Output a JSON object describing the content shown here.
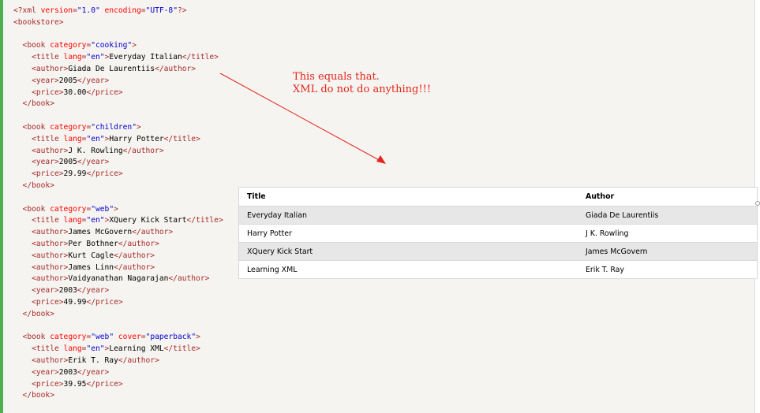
{
  "code_lines": [
    [
      {
        "c": "tag",
        "t": "<?xml "
      },
      {
        "c": "attr",
        "t": "version"
      },
      {
        "c": "tag",
        "t": "="
      },
      {
        "c": "val",
        "t": "\"1.0\""
      },
      {
        "c": "tag",
        "t": " "
      },
      {
        "c": "attr",
        "t": "encoding"
      },
      {
        "c": "tag",
        "t": "="
      },
      {
        "c": "val",
        "t": "\"UTF-8\""
      },
      {
        "c": "tag",
        "t": "?>"
      }
    ],
    [
      {
        "c": "tag",
        "t": "<bookstore>"
      }
    ],
    [],
    [
      {
        "c": "tag",
        "t": "  <book "
      },
      {
        "c": "attr",
        "t": "category"
      },
      {
        "c": "tag",
        "t": "="
      },
      {
        "c": "val",
        "t": "\"cooking\""
      },
      {
        "c": "tag",
        "t": ">"
      }
    ],
    [
      {
        "c": "tag",
        "t": "    <title "
      },
      {
        "c": "attr",
        "t": "lang"
      },
      {
        "c": "tag",
        "t": "="
      },
      {
        "c": "val",
        "t": "\"en\""
      },
      {
        "c": "tag",
        "t": ">"
      },
      {
        "c": "txt",
        "t": "Everyday Italian"
      },
      {
        "c": "tag",
        "t": "</title>"
      }
    ],
    [
      {
        "c": "tag",
        "t": "    <author>"
      },
      {
        "c": "txt",
        "t": "Giada De Laurentiis"
      },
      {
        "c": "tag",
        "t": "</author>"
      }
    ],
    [
      {
        "c": "tag",
        "t": "    <year>"
      },
      {
        "c": "txt",
        "t": "2005"
      },
      {
        "c": "tag",
        "t": "</year>"
      }
    ],
    [
      {
        "c": "tag",
        "t": "    <price>"
      },
      {
        "c": "txt",
        "t": "30.00"
      },
      {
        "c": "tag",
        "t": "</price>"
      }
    ],
    [
      {
        "c": "tag",
        "t": "  </book>"
      }
    ],
    [],
    [
      {
        "c": "tag",
        "t": "  <book "
      },
      {
        "c": "attr",
        "t": "category"
      },
      {
        "c": "tag",
        "t": "="
      },
      {
        "c": "val",
        "t": "\"children\""
      },
      {
        "c": "tag",
        "t": ">"
      }
    ],
    [
      {
        "c": "tag",
        "t": "    <title "
      },
      {
        "c": "attr",
        "t": "lang"
      },
      {
        "c": "tag",
        "t": "="
      },
      {
        "c": "val",
        "t": "\"en\""
      },
      {
        "c": "tag",
        "t": ">"
      },
      {
        "c": "txt",
        "t": "Harry Potter"
      },
      {
        "c": "tag",
        "t": "</title>"
      }
    ],
    [
      {
        "c": "tag",
        "t": "    <author>"
      },
      {
        "c": "txt",
        "t": "J K. Rowling"
      },
      {
        "c": "tag",
        "t": "</author>"
      }
    ],
    [
      {
        "c": "tag",
        "t": "    <year>"
      },
      {
        "c": "txt",
        "t": "2005"
      },
      {
        "c": "tag",
        "t": "</year>"
      }
    ],
    [
      {
        "c": "tag",
        "t": "    <price>"
      },
      {
        "c": "txt",
        "t": "29.99"
      },
      {
        "c": "tag",
        "t": "</price>"
      }
    ],
    [
      {
        "c": "tag",
        "t": "  </book>"
      }
    ],
    [],
    [
      {
        "c": "tag",
        "t": "  <book "
      },
      {
        "c": "attr",
        "t": "category"
      },
      {
        "c": "tag",
        "t": "="
      },
      {
        "c": "val",
        "t": "\"web\""
      },
      {
        "c": "tag",
        "t": ">"
      }
    ],
    [
      {
        "c": "tag",
        "t": "    <title "
      },
      {
        "c": "attr",
        "t": "lang"
      },
      {
        "c": "tag",
        "t": "="
      },
      {
        "c": "val",
        "t": "\"en\""
      },
      {
        "c": "tag",
        "t": ">"
      },
      {
        "c": "txt",
        "t": "XQuery Kick Start"
      },
      {
        "c": "tag",
        "t": "</title>"
      }
    ],
    [
      {
        "c": "tag",
        "t": "    <author>"
      },
      {
        "c": "txt",
        "t": "James McGovern"
      },
      {
        "c": "tag",
        "t": "</author>"
      }
    ],
    [
      {
        "c": "tag",
        "t": "    <author>"
      },
      {
        "c": "txt",
        "t": "Per Bothner"
      },
      {
        "c": "tag",
        "t": "</author>"
      }
    ],
    [
      {
        "c": "tag",
        "t": "    <author>"
      },
      {
        "c": "txt",
        "t": "Kurt Cagle"
      },
      {
        "c": "tag",
        "t": "</author>"
      }
    ],
    [
      {
        "c": "tag",
        "t": "    <author>"
      },
      {
        "c": "txt",
        "t": "James Linn"
      },
      {
        "c": "tag",
        "t": "</author>"
      }
    ],
    [
      {
        "c": "tag",
        "t": "    <author>"
      },
      {
        "c": "txt",
        "t": "Vaidyanathan Nagarajan"
      },
      {
        "c": "tag",
        "t": "</author>"
      }
    ],
    [
      {
        "c": "tag",
        "t": "    <year>"
      },
      {
        "c": "txt",
        "t": "2003"
      },
      {
        "c": "tag",
        "t": "</year>"
      }
    ],
    [
      {
        "c": "tag",
        "t": "    <price>"
      },
      {
        "c": "txt",
        "t": "49.99"
      },
      {
        "c": "tag",
        "t": "</price>"
      }
    ],
    [
      {
        "c": "tag",
        "t": "  </book>"
      }
    ],
    [],
    [
      {
        "c": "tag",
        "t": "  <book "
      },
      {
        "c": "attr",
        "t": "category"
      },
      {
        "c": "tag",
        "t": "="
      },
      {
        "c": "val",
        "t": "\"web\""
      },
      {
        "c": "tag",
        "t": " "
      },
      {
        "c": "attr",
        "t": "cover"
      },
      {
        "c": "tag",
        "t": "="
      },
      {
        "c": "val",
        "t": "\"paperback\""
      },
      {
        "c": "tag",
        "t": ">"
      }
    ],
    [
      {
        "c": "tag",
        "t": "    <title "
      },
      {
        "c": "attr",
        "t": "lang"
      },
      {
        "c": "tag",
        "t": "="
      },
      {
        "c": "val",
        "t": "\"en\""
      },
      {
        "c": "tag",
        "t": ">"
      },
      {
        "c": "txt",
        "t": "Learning XML"
      },
      {
        "c": "tag",
        "t": "</title>"
      }
    ],
    [
      {
        "c": "tag",
        "t": "    <author>"
      },
      {
        "c": "txt",
        "t": "Erik T. Ray"
      },
      {
        "c": "tag",
        "t": "</author>"
      }
    ],
    [
      {
        "c": "tag",
        "t": "    <year>"
      },
      {
        "c": "txt",
        "t": "2003"
      },
      {
        "c": "tag",
        "t": "</year>"
      }
    ],
    [
      {
        "c": "tag",
        "t": "    <price>"
      },
      {
        "c": "txt",
        "t": "39.95"
      },
      {
        "c": "tag",
        "t": "</price>"
      }
    ],
    [
      {
        "c": "tag",
        "t": "  </book>"
      }
    ]
  ],
  "annotation": {
    "line1": "This equals that.",
    "line2": "XML do not do anything!!!",
    "color": "#e2261c"
  },
  "table": {
    "headers": [
      "Title",
      "Author"
    ],
    "rows": [
      [
        "Everyday Italian",
        "Giada De Laurentiis"
      ],
      [
        "Harry Potter",
        "J K. Rowling"
      ],
      [
        "XQuery Kick Start",
        "James McGovern"
      ],
      [
        "Learning XML",
        "Erik T. Ray"
      ]
    ]
  },
  "colors": {
    "code_background": "#f6f4f0",
    "accent_border": "#4caf50",
    "xml_tag": "#a52a2a",
    "xml_attribute": "#ff0000",
    "xml_value": "#0000cd",
    "table_stripe": "#e7e7e7"
  }
}
